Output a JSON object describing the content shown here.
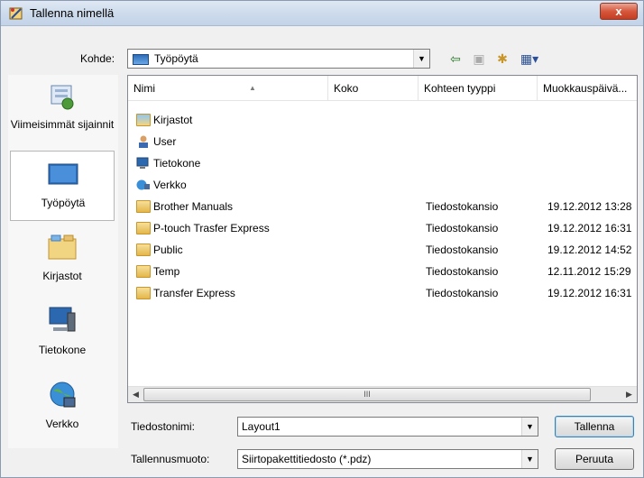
{
  "window": {
    "title": "Tallenna nimellä",
    "close_label": "x"
  },
  "location": {
    "label": "Kohde:",
    "value": "Työpöytä"
  },
  "places": [
    {
      "label": "Viimeisimmät sijainnit",
      "icon": "recent-places-icon"
    },
    {
      "label": "Työpöytä",
      "icon": "desktop-icon"
    },
    {
      "label": "Kirjastot",
      "icon": "libraries-icon"
    },
    {
      "label": "Tietokone",
      "icon": "computer-icon"
    },
    {
      "label": "Verkko",
      "icon": "network-icon"
    }
  ],
  "columns": {
    "name": "Nimi",
    "size": "Koko",
    "type": "Kohteen tyyppi",
    "modified": "Muokkauspäivä..."
  },
  "items": [
    {
      "name": "Kirjastot",
      "type": "",
      "date": "",
      "icon": "libraries-icon"
    },
    {
      "name": "User",
      "type": "",
      "date": "",
      "icon": "user-icon"
    },
    {
      "name": "Tietokone",
      "type": "",
      "date": "",
      "icon": "computer-icon"
    },
    {
      "name": "Verkko",
      "type": "",
      "date": "",
      "icon": "network-icon"
    },
    {
      "name": "Brother Manuals",
      "type": "Tiedostokansio",
      "date": "19.12.2012 13:28",
      "icon": "folder-icon"
    },
    {
      "name": "P-touch Trasfer Express",
      "type": "Tiedostokansio",
      "date": "19.12.2012 16:31",
      "icon": "folder-icon"
    },
    {
      "name": "Public",
      "type": "Tiedostokansio",
      "date": "19.12.2012 14:52",
      "icon": "folder-icon"
    },
    {
      "name": "Temp",
      "type": "Tiedostokansio",
      "date": "12.11.2012 15:29",
      "icon": "folder-icon"
    },
    {
      "name": "Transfer Express",
      "type": "Tiedostokansio",
      "date": "19.12.2012 16:31",
      "icon": "folder-icon"
    }
  ],
  "scrollbar": {
    "grip": "III"
  },
  "filename": {
    "label": "Tiedostonimi:",
    "value": "Layout1"
  },
  "filetype": {
    "label": "Tallennusmuoto:",
    "value": "Siirtopakettitiedosto (*.pdz)"
  },
  "buttons": {
    "save": "Tallenna",
    "cancel": "Peruuta"
  }
}
